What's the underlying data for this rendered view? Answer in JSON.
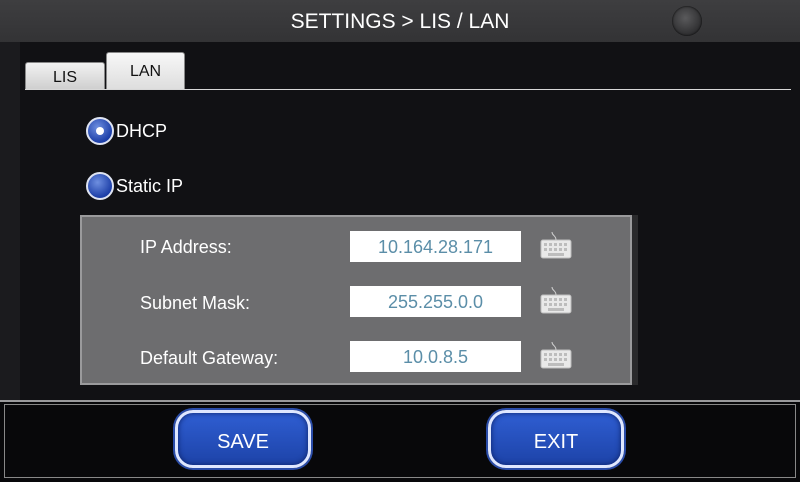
{
  "header": {
    "title": "SETTINGS > LIS / LAN",
    "lis_indicator": "LIS"
  },
  "tabs": [
    {
      "label": "LIS",
      "active": false
    },
    {
      "label": "LAN",
      "active": true
    }
  ],
  "network_mode": {
    "options": [
      {
        "label": "DHCP",
        "selected": true
      },
      {
        "label": "Static IP",
        "selected": false
      }
    ]
  },
  "static_ip": {
    "fields": [
      {
        "label": "IP Address:",
        "value": "10.164.28.171",
        "icon": "keyboard-icon"
      },
      {
        "label": "Subnet Mask:",
        "value": "255.255.0.0",
        "icon": "keyboard-icon"
      },
      {
        "label": "Default Gateway:",
        "value": "10.0.8.5",
        "icon": "keyboard-icon"
      }
    ]
  },
  "footer": {
    "save_label": "SAVE",
    "exit_label": "EXIT"
  },
  "colors": {
    "accent_blue": "#2a55c4",
    "indicator_cyan": "#5ed3de",
    "value_text": "#5b8ea8"
  }
}
